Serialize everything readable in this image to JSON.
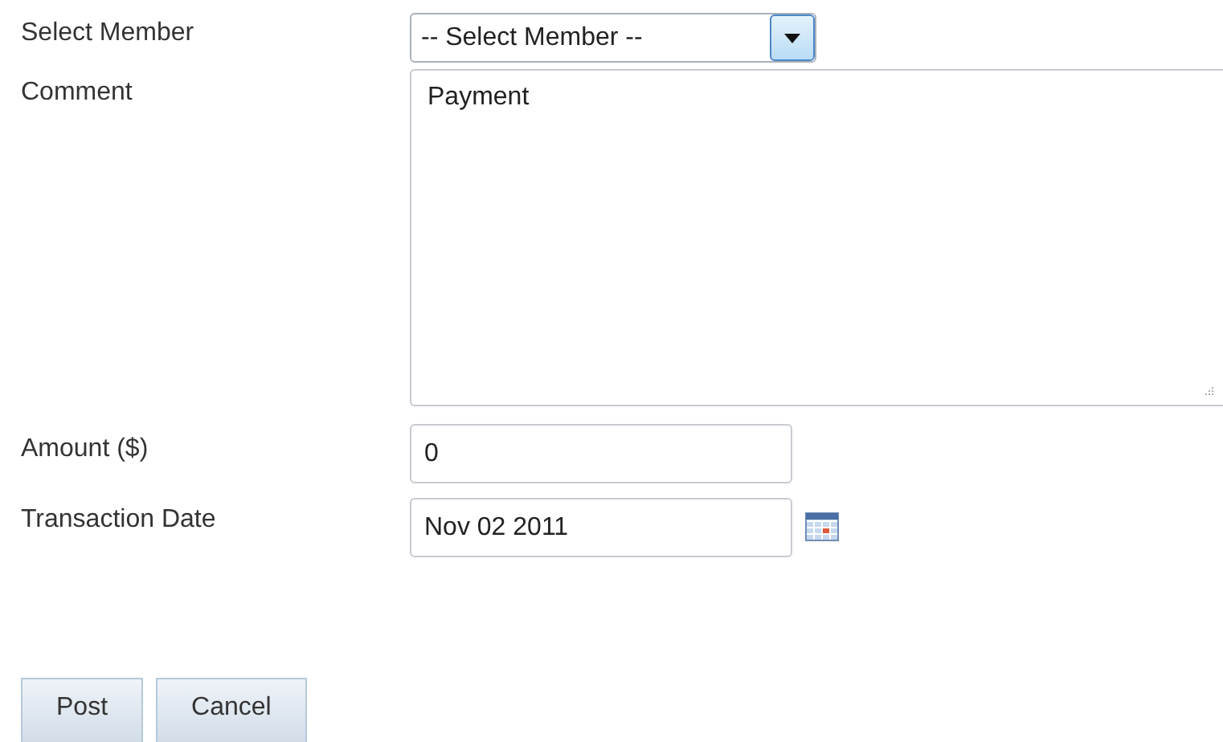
{
  "fields": [
    {
      "kind": "select",
      "label": "Select Member",
      "value": "-- Select Member --"
    },
    {
      "kind": "textarea",
      "label": "Comment",
      "value": "Payment"
    },
    {
      "kind": "text",
      "label": "Amount ($)",
      "value": "0"
    },
    {
      "kind": "date",
      "label": "Transaction Date",
      "value": "Nov 02 2011"
    }
  ],
  "buttons": [
    "Post",
    "Cancel"
  ]
}
